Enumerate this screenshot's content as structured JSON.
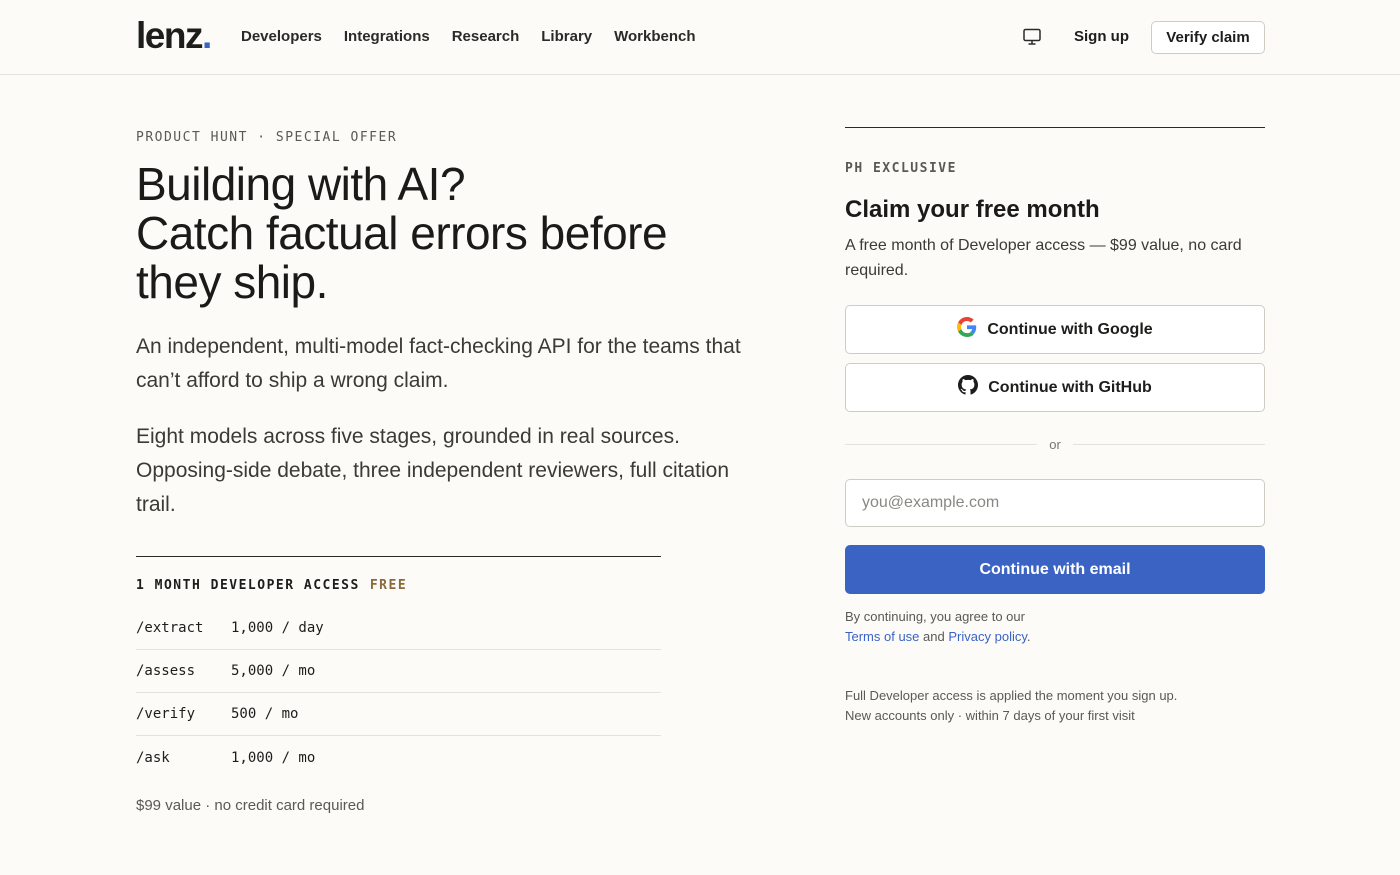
{
  "nav": {
    "logo": "lenz",
    "logo_dot": ".",
    "links": [
      "Developers",
      "Integrations",
      "Research",
      "Library",
      "Workbench"
    ],
    "sign_up": "Sign up",
    "verify_claim": "Verify claim"
  },
  "hero": {
    "eyebrow": "PRODUCT HUNT · SPECIAL OFFER",
    "title_lines": [
      "Building with AI?",
      "Catch factual errors before",
      "they ship."
    ],
    "lead1": "An independent, multi-model fact-checking API for the teams that can’t afford to ship a wrong claim.",
    "lead2": "Eight models across five stages, grounded in real sources. Opposing-side debate, three independent reviewers, full citation trail."
  },
  "access": {
    "title": "1 MONTH DEVELOPER ACCESS",
    "badge": "FREE",
    "rows": [
      {
        "endpoint": "/extract",
        "quota": "1,000 / day"
      },
      {
        "endpoint": "/assess",
        "quota": "5,000 / mo"
      },
      {
        "endpoint": "/verify",
        "quota": "500 / mo"
      },
      {
        "endpoint": "/ask",
        "quota": "1,000 / mo"
      }
    ],
    "value_note": "$99 value · no credit card required"
  },
  "panel": {
    "eyebrow": "PH EXCLUSIVE",
    "title": "Claim your free month",
    "description": "A free month of Developer access — $99 value, no card required.",
    "google": "Continue with Google",
    "github": "Continue with GitHub",
    "divider": "or",
    "email_placeholder": "you@example.com",
    "email_button": "Continue with email",
    "terms_prefix": "By continuing, you agree to our",
    "terms_link": "Terms of use",
    "terms_and": "and",
    "privacy_link": "Privacy policy",
    "terms_suffix": ".",
    "fine_line1": "Full Developer access is applied the moment you sign up.",
    "fine_line2": "New accounts only · within 7 days of your first visit"
  },
  "colors": {
    "accent": "#3b63c4",
    "free_badge": "#8a6a3c",
    "background": "#fcfbf7"
  },
  "icons": {
    "monitor": "monitor-icon",
    "google": "google-icon",
    "github": "github-icon"
  }
}
